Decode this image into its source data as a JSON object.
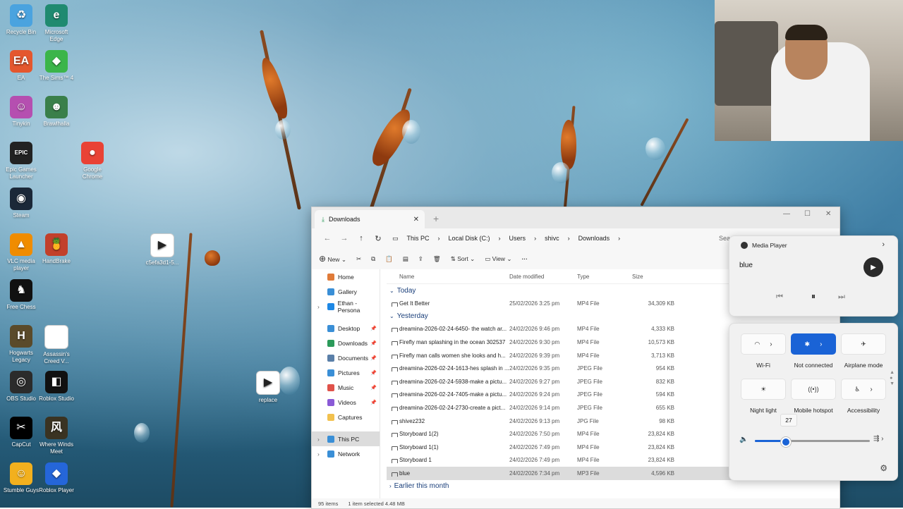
{
  "desktop": {
    "icons": [
      {
        "label": "Recycle Bin",
        "icon": "recycle-bin-icon",
        "color": "#4aa3df",
        "glyph": "♻"
      },
      {
        "label": "Microsoft Edge",
        "icon": "edge-icon",
        "color": "#1f8a70",
        "glyph": "e"
      },
      {
        "label": "EA",
        "icon": "ea-icon",
        "color": "#e4572e",
        "glyph": "EA"
      },
      {
        "label": "The Sims™ 4",
        "icon": "sims-icon",
        "color": "#3bb54a",
        "glyph": "◆"
      },
      {
        "label": "Tinykin",
        "icon": "tinykin-icon",
        "color": "#b54fb0",
        "glyph": "☺"
      },
      {
        "label": "Brawlhalla",
        "icon": "brawlhalla-icon",
        "color": "#3a7f4a",
        "glyph": "☻"
      },
      {
        "label": "Epic Games Launcher",
        "icon": "epic-games-icon",
        "color": "#222222",
        "glyph": "EPIC"
      },
      {
        "label": "Google Chrome",
        "icon": "chrome-icon",
        "color": "#e94235",
        "glyph": "●"
      },
      {
        "label": "Steam",
        "icon": "steam-icon",
        "color": "#1b2838",
        "glyph": "◉"
      },
      {
        "label": "VLC media player",
        "icon": "vlc-icon",
        "color": "#f08c00",
        "glyph": "▲"
      },
      {
        "label": "HandBrake",
        "icon": "handbrake-icon",
        "color": "#c2402b",
        "glyph": "🍍"
      },
      {
        "label": "Free Chess",
        "icon": "chess-icon",
        "color": "#111111",
        "glyph": "♞"
      },
      {
        "label": "Hogwarts Legacy",
        "icon": "hogwarts-icon",
        "color": "#5a4a2a",
        "glyph": "H"
      },
      {
        "label": "Assassin's Creed V...",
        "icon": "document-icon",
        "color": "#ffffff",
        "glyph": ""
      },
      {
        "label": "OBS Studio",
        "icon": "obs-icon",
        "color": "#2b2b2b",
        "glyph": "◎"
      },
      {
        "label": "Roblox Studio",
        "icon": "roblox-studio-icon",
        "color": "#111111",
        "glyph": "◧"
      },
      {
        "label": "CapCut",
        "icon": "capcut-icon",
        "color": "#000000",
        "glyph": "✂"
      },
      {
        "label": "Where Winds Meet",
        "icon": "where-winds-meet-icon",
        "color": "#3a3322",
        "glyph": "风"
      },
      {
        "label": "Stumble Guys",
        "icon": "stumble-guys-icon",
        "color": "#f2b01e",
        "glyph": "☺"
      },
      {
        "label": "Roblox Player",
        "icon": "roblox-player-icon",
        "color": "#2566d9",
        "glyph": "◆"
      },
      {
        "label": "c5efa3d1-5...",
        "icon": "media-file-icon",
        "color": "#ffffff",
        "glyph": "▶"
      },
      {
        "label": "replace",
        "icon": "media-file-icon",
        "color": "#ffffff",
        "glyph": "▶"
      }
    ]
  },
  "explorer": {
    "tab_title": "Downloads",
    "breadcrumb": [
      "This PC",
      "Local Disk (C:)",
      "Users",
      "shivc",
      "Downloads"
    ],
    "search_placeholder": "Sea",
    "commands": {
      "new": "New",
      "sort": "Sort",
      "view": "View"
    },
    "nav_items": [
      {
        "label": "Home",
        "icon": "home-icon",
        "color": "#e07b39",
        "pin": false
      },
      {
        "label": "Gallery",
        "icon": "gallery-icon",
        "color": "#3a8fd6",
        "pin": false
      },
      {
        "label": "Ethan - Persona",
        "icon": "onedrive-icon",
        "color": "#1e88e5",
        "pin": false
      },
      {
        "label": "Desktop",
        "icon": "desktop-icon",
        "color": "#3a8fd6",
        "pin": true
      },
      {
        "label": "Downloads",
        "icon": "downloads-icon",
        "color": "#2b9a5a",
        "pin": true
      },
      {
        "label": "Documents",
        "icon": "documents-icon",
        "color": "#5a7fa8",
        "pin": true
      },
      {
        "label": "Pictures",
        "icon": "pictures-icon",
        "color": "#3a8fd6",
        "pin": true
      },
      {
        "label": "Music",
        "icon": "music-icon",
        "color": "#e0524a",
        "pin": true
      },
      {
        "label": "Videos",
        "icon": "videos-icon",
        "color": "#8a5ad6",
        "pin": true
      },
      {
        "label": "Captures",
        "icon": "folder-icon",
        "color": "#f2c14e",
        "pin": false
      },
      {
        "label": "This PC",
        "icon": "this-pc-icon",
        "color": "#3a8fd6",
        "pin": false
      },
      {
        "label": "Network",
        "icon": "network-icon",
        "color": "#3a8fd6",
        "pin": false
      }
    ],
    "columns": [
      "Name",
      "Date modified",
      "Type",
      "Size"
    ],
    "groups": {
      "today": "Today",
      "yesterday": "Yesterday",
      "earlier": "Earlier this month"
    },
    "files_today": [
      {
        "name": "Get It Better",
        "date": "25/02/2026 3:25 pm",
        "type": "MP4 File",
        "size": "34,309 KB"
      }
    ],
    "files_yesterday": [
      {
        "name": "dreamina-2026-02-24-6450- the watch ar...",
        "date": "24/02/2026 9:46 pm",
        "type": "MP4 File",
        "size": "4,333 KB"
      },
      {
        "name": "Firefly man splashing in the ocean 302537",
        "date": "24/02/2026 9:30 pm",
        "type": "MP4 File",
        "size": "10,573 KB"
      },
      {
        "name": "Firefly man calls women she looks and h...",
        "date": "24/02/2026 9:39 pm",
        "type": "MP4 File",
        "size": "3,713 KB"
      },
      {
        "name": "dreamina-2026-02-24-1613-hes splash in ...",
        "date": "24/02/2026 9:35 pm",
        "type": "JPEG File",
        "size": "954 KB"
      },
      {
        "name": "dreamina-2026-02-24-5938-make a pictu...",
        "date": "24/02/2026 9:27 pm",
        "type": "JPEG File",
        "size": "832 KB"
      },
      {
        "name": "dreamina-2026-02-24-7405-make a pictu...",
        "date": "24/02/2026 9:24 pm",
        "type": "JPEG File",
        "size": "594 KB"
      },
      {
        "name": "dreamina-2026-02-24-2730-create a pict...",
        "date": "24/02/2026 9:14 pm",
        "type": "JPEG File",
        "size": "655 KB"
      },
      {
        "name": "shivez232",
        "date": "24/02/2026 9:13 pm",
        "type": "JPG File",
        "size": "98 KB"
      },
      {
        "name": "Storyboard 1(2)",
        "date": "24/02/2026 7:50 pm",
        "type": "MP4 File",
        "size": "23,824 KB"
      },
      {
        "name": "Storyboard 1(1)",
        "date": "24/02/2026 7:49 pm",
        "type": "MP4 File",
        "size": "23,824 KB"
      },
      {
        "name": "Storyboard 1",
        "date": "24/02/2026 7:49 pm",
        "type": "MP4 File",
        "size": "23,824 KB"
      },
      {
        "name": "blue",
        "date": "24/02/2026 7:34 pm",
        "type": "MP3 File",
        "size": "4,596 KB"
      }
    ],
    "status": {
      "items": "95 items",
      "selected": "1 item selected  4.48 MB"
    }
  },
  "media": {
    "app": "Media Player",
    "track": "blue"
  },
  "quick_settings": {
    "tiles": [
      {
        "label": "Wi-Fi",
        "icon": "wifi-icon",
        "on": false
      },
      {
        "label": "Not connected",
        "icon": "bluetooth-icon",
        "on": true
      },
      {
        "label": "Airplane mode",
        "icon": "airplane-icon",
        "on": false
      },
      {
        "label": "Night light",
        "icon": "night-light-icon",
        "on": false
      },
      {
        "label": "Mobile hotspot",
        "icon": "hotspot-icon",
        "on": false
      },
      {
        "label": "Accessibility",
        "icon": "accessibility-icon",
        "on": false
      }
    ],
    "volume_tooltip": "27",
    "volume_level": 0.27,
    "accent": "#1a63d6"
  }
}
